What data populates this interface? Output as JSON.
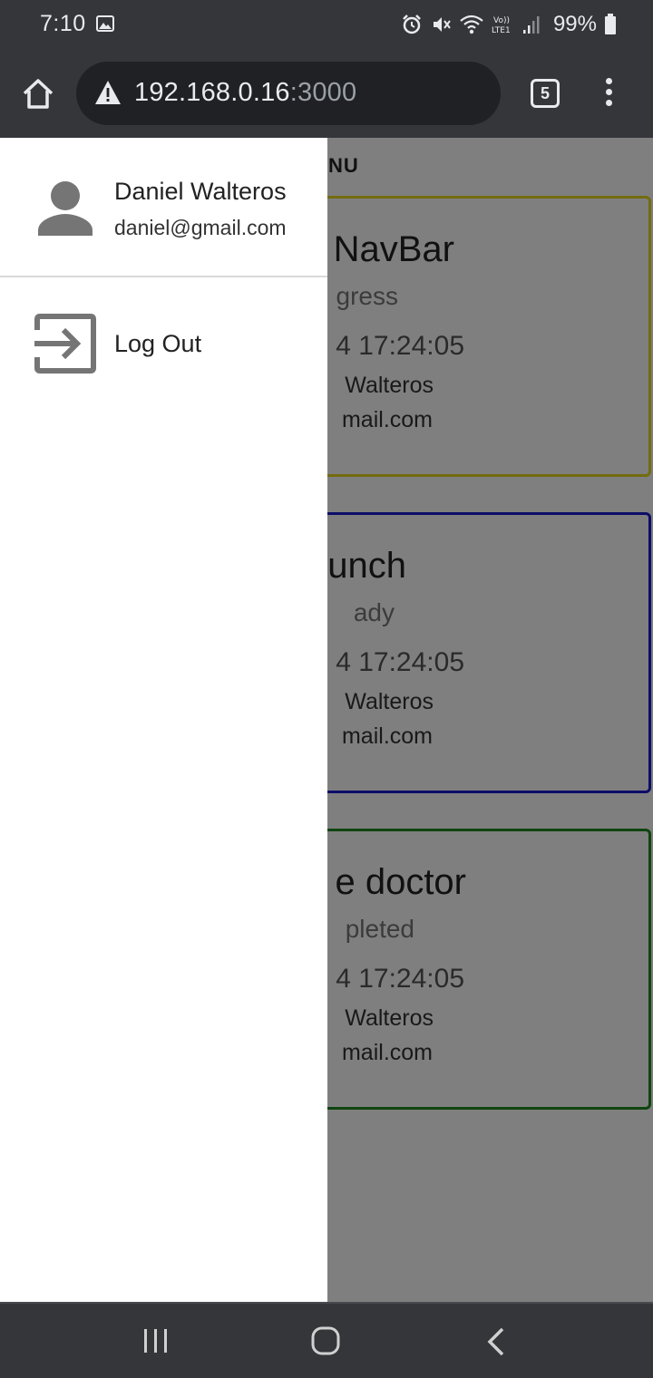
{
  "status_bar": {
    "time": "7:10",
    "battery": "99%",
    "icons": [
      "gallery-icon",
      "alarm-icon",
      "mute-icon",
      "wifi-icon",
      "volte-icon",
      "signal-icon",
      "battery-icon"
    ]
  },
  "browser": {
    "url_host": "192.168.0.16",
    "url_port": ":3000",
    "tab_count": "5"
  },
  "page": {
    "header_fragment": "NU",
    "cards": [
      {
        "title": "NavBar",
        "status": "gress",
        "date": "4 17:24:05",
        "name": "Walteros",
        "email": "mail.com",
        "border_color": "#e6d81e"
      },
      {
        "title": "unch",
        "status": "ady",
        "date": "4 17:24:05",
        "name": "Walteros",
        "email": "mail.com",
        "border_color": "#1a1ad0"
      },
      {
        "title": "e doctor",
        "status": "pleted",
        "date": "4 17:24:05",
        "name": "Walteros",
        "email": "mail.com",
        "border_color": "#1e8a1e"
      }
    ]
  },
  "drawer": {
    "user_name": "Daniel Walteros",
    "user_email": "daniel@gmail.com",
    "logout_label": "Log Out"
  },
  "colors": {
    "chrome_dark": "#35363a",
    "url_box": "#202124",
    "icon_grey": "#757575",
    "scrim": "#808080"
  }
}
